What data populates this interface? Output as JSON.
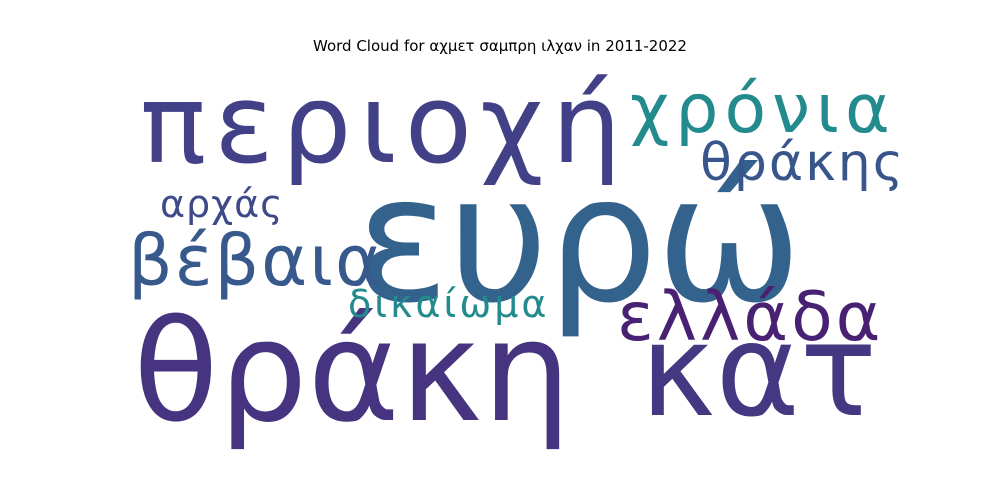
{
  "chart_data": {
    "type": "word_cloud",
    "title": "Word Cloud for αχμετ σαμπρη ιλχαν in 2011-2022",
    "words": [
      {
        "text": "ευρώ",
        "weight": 1.0,
        "color": "#33638d"
      },
      {
        "text": "θράκη",
        "weight": 0.92,
        "color": "#463480"
      },
      {
        "text": "περιοχή",
        "weight": 0.86,
        "color": "#424086"
      },
      {
        "text": "κατ",
        "weight": 0.8,
        "color": "#453781"
      },
      {
        "text": "χρόνια",
        "weight": 0.48,
        "color": "#238a8d"
      },
      {
        "text": "ελλάδα",
        "weight": 0.46,
        "color": "#482173"
      },
      {
        "text": "βέβαια",
        "weight": 0.45,
        "color": "#38598c"
      },
      {
        "text": "θράκης",
        "weight": 0.38,
        "color": "#39568c"
      },
      {
        "text": "δικαίωμα",
        "weight": 0.32,
        "color": "#238a8d"
      },
      {
        "text": "αρχάς",
        "weight": 0.3,
        "color": "#3e4989"
      }
    ]
  }
}
